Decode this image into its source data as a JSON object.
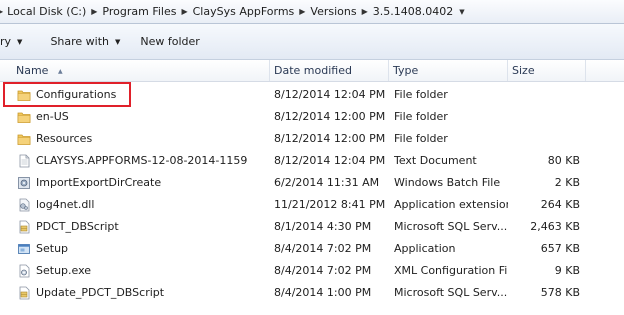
{
  "breadcrumb": {
    "items": [
      "Local Disk (C:)",
      "Program Files",
      "ClaySys AppForms",
      "Versions",
      "3.5.1408.0402"
    ]
  },
  "toolbar": {
    "organize_label": "ry",
    "share_label": "Share with",
    "new_folder_label": "New folder"
  },
  "columns": {
    "name": "Name",
    "date": "Date modified",
    "type": "Type",
    "size": "Size"
  },
  "files": [
    {
      "name": "Configurations",
      "date": "8/12/2014 12:04 PM",
      "type": "File folder",
      "size": "",
      "icon": "folder-icon"
    },
    {
      "name": "en-US",
      "date": "8/12/2014 12:00 PM",
      "type": "File folder",
      "size": "",
      "icon": "folder-icon"
    },
    {
      "name": "Resources",
      "date": "8/12/2014 12:00 PM",
      "type": "File folder",
      "size": "",
      "icon": "folder-icon"
    },
    {
      "name": "CLAYSYS.APPFORMS-12-08-2014-1159",
      "date": "8/12/2014 12:04 PM",
      "type": "Text Document",
      "size": "80 KB",
      "icon": "text-document-icon"
    },
    {
      "name": "ImportExportDirCreate",
      "date": "6/2/2014 11:31 AM",
      "type": "Windows Batch File",
      "size": "2 KB",
      "icon": "batch-file-icon"
    },
    {
      "name": "log4net.dll",
      "date": "11/21/2012 8:41 PM",
      "type": "Application extension",
      "size": "264 KB",
      "icon": "dll-file-icon"
    },
    {
      "name": "PDCT_DBScript",
      "date": "8/1/2014 4:30 PM",
      "type": "Microsoft SQL Serv...",
      "size": "2,463 KB",
      "icon": "sql-file-icon"
    },
    {
      "name": "Setup",
      "date": "8/4/2014 7:02 PM",
      "type": "Application",
      "size": "657 KB",
      "icon": "application-icon"
    },
    {
      "name": "Setup.exe",
      "date": "8/4/2014 7:02 PM",
      "type": "XML Configuration File",
      "size": "9 KB",
      "icon": "config-file-icon"
    },
    {
      "name": "Update_PDCT_DBScript",
      "date": "8/4/2014 1:00 PM",
      "type": "Microsoft SQL Serv...",
      "size": "578 KB",
      "icon": "sql-file-icon"
    }
  ],
  "colors": {
    "highlight": "#e0202a",
    "folder": "#e8b84a"
  }
}
